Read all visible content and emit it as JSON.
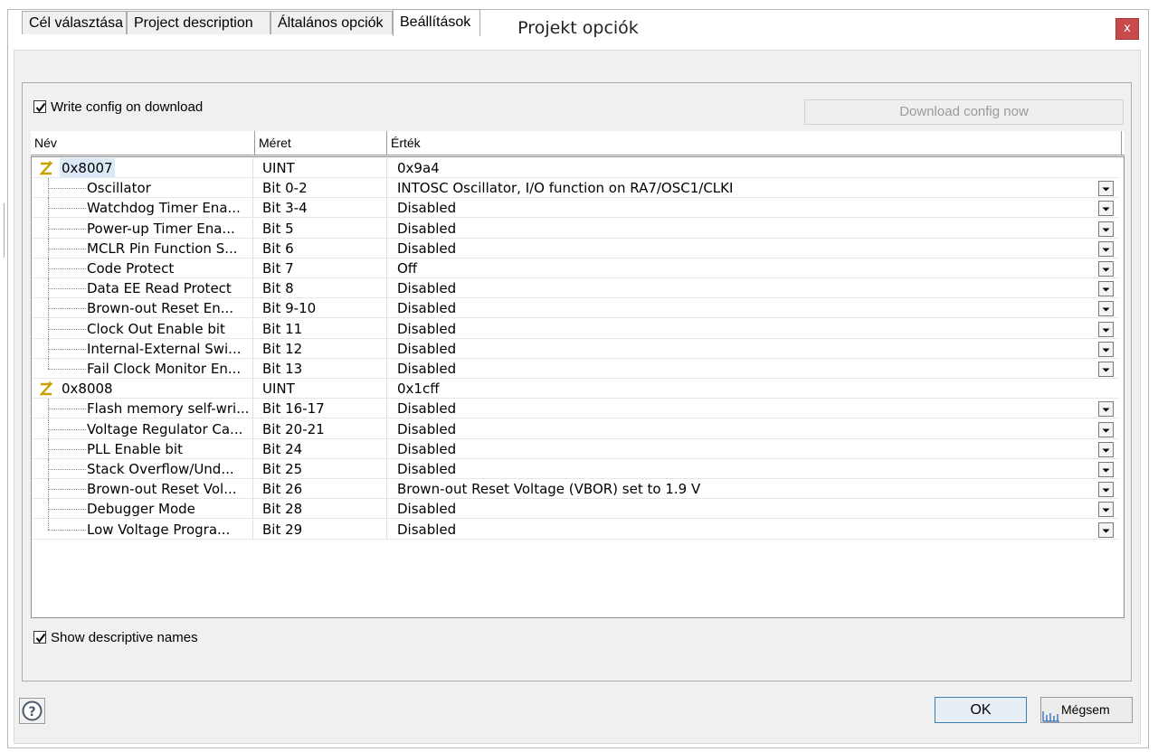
{
  "dialog": {
    "title": "Projekt opciók",
    "close_glyph": "x"
  },
  "tabs": [
    {
      "label": "Cél választása",
      "active": false
    },
    {
      "label": "Project description",
      "active": false
    },
    {
      "label": "Általános opciók",
      "active": false
    },
    {
      "label": "Beállítások",
      "active": true
    }
  ],
  "settings": {
    "write_config_label": "Write config on download",
    "write_config_checked": true,
    "download_button_label": "Download config now",
    "show_names_label": "Show descriptive names",
    "show_names_checked": true
  },
  "grid": {
    "columns": [
      "Név",
      "Méret",
      "Érték"
    ],
    "groups": [
      {
        "name": "0x8007",
        "size": "UINT",
        "value": "0x9a4",
        "selected": true,
        "rows": [
          {
            "name": "Oscillator",
            "size": "Bit 0-2",
            "value": "INTOSC Oscillator, I/O function on RA7/OSC1/CLKI"
          },
          {
            "name": "Watchdog Timer Ena...",
            "size": "Bit 3-4",
            "value": "Disabled"
          },
          {
            "name": "Power-up Timer Ena...",
            "size": "Bit 5",
            "value": "Disabled"
          },
          {
            "name": "MCLR Pin Function S...",
            "size": "Bit 6",
            "value": "Disabled"
          },
          {
            "name": "Code Protect",
            "size": "Bit 7",
            "value": "Off"
          },
          {
            "name": "Data EE Read Protect",
            "size": "Bit 8",
            "value": "Disabled"
          },
          {
            "name": "Brown-out Reset En...",
            "size": "Bit 9-10",
            "value": "Disabled"
          },
          {
            "name": "Clock Out Enable bit",
            "size": "Bit 11",
            "value": "Disabled"
          },
          {
            "name": "Internal-External Swi...",
            "size": "Bit 12",
            "value": "Disabled"
          },
          {
            "name": "Fail Clock Monitor En...",
            "size": "Bit 13",
            "value": "Disabled"
          }
        ]
      },
      {
        "name": "0x8008",
        "size": "UINT",
        "value": "0x1cff",
        "selected": false,
        "rows": [
          {
            "name": "Flash memory self-wri...",
            "size": "Bit 16-17",
            "value": "Disabled"
          },
          {
            "name": "Voltage Regulator Ca...",
            "size": "Bit 20-21",
            "value": "Disabled"
          },
          {
            "name": "PLL Enable bit",
            "size": "Bit 24",
            "value": "Disabled"
          },
          {
            "name": "Stack Overflow/Und...",
            "size": "Bit 25",
            "value": "Disabled"
          },
          {
            "name": "Brown-out Reset Vol...",
            "size": "Bit 26",
            "value": "Brown-out Reset Voltage (VBOR) set to 1.9 V"
          },
          {
            "name": "Debugger Mode",
            "size": "Bit 28",
            "value": "Disabled"
          },
          {
            "name": "Low Voltage Progra...",
            "size": "Bit 29",
            "value": "Disabled"
          }
        ]
      }
    ]
  },
  "footer": {
    "ok_label": "OK",
    "cancel_label": "Mégsem",
    "help_icon": "question-circle-icon"
  },
  "colors": {
    "close_button": "#c74b4b",
    "selection": "#dbe9f7",
    "ok_border": "#3c7fb1",
    "group_icon": "#c8a000"
  }
}
